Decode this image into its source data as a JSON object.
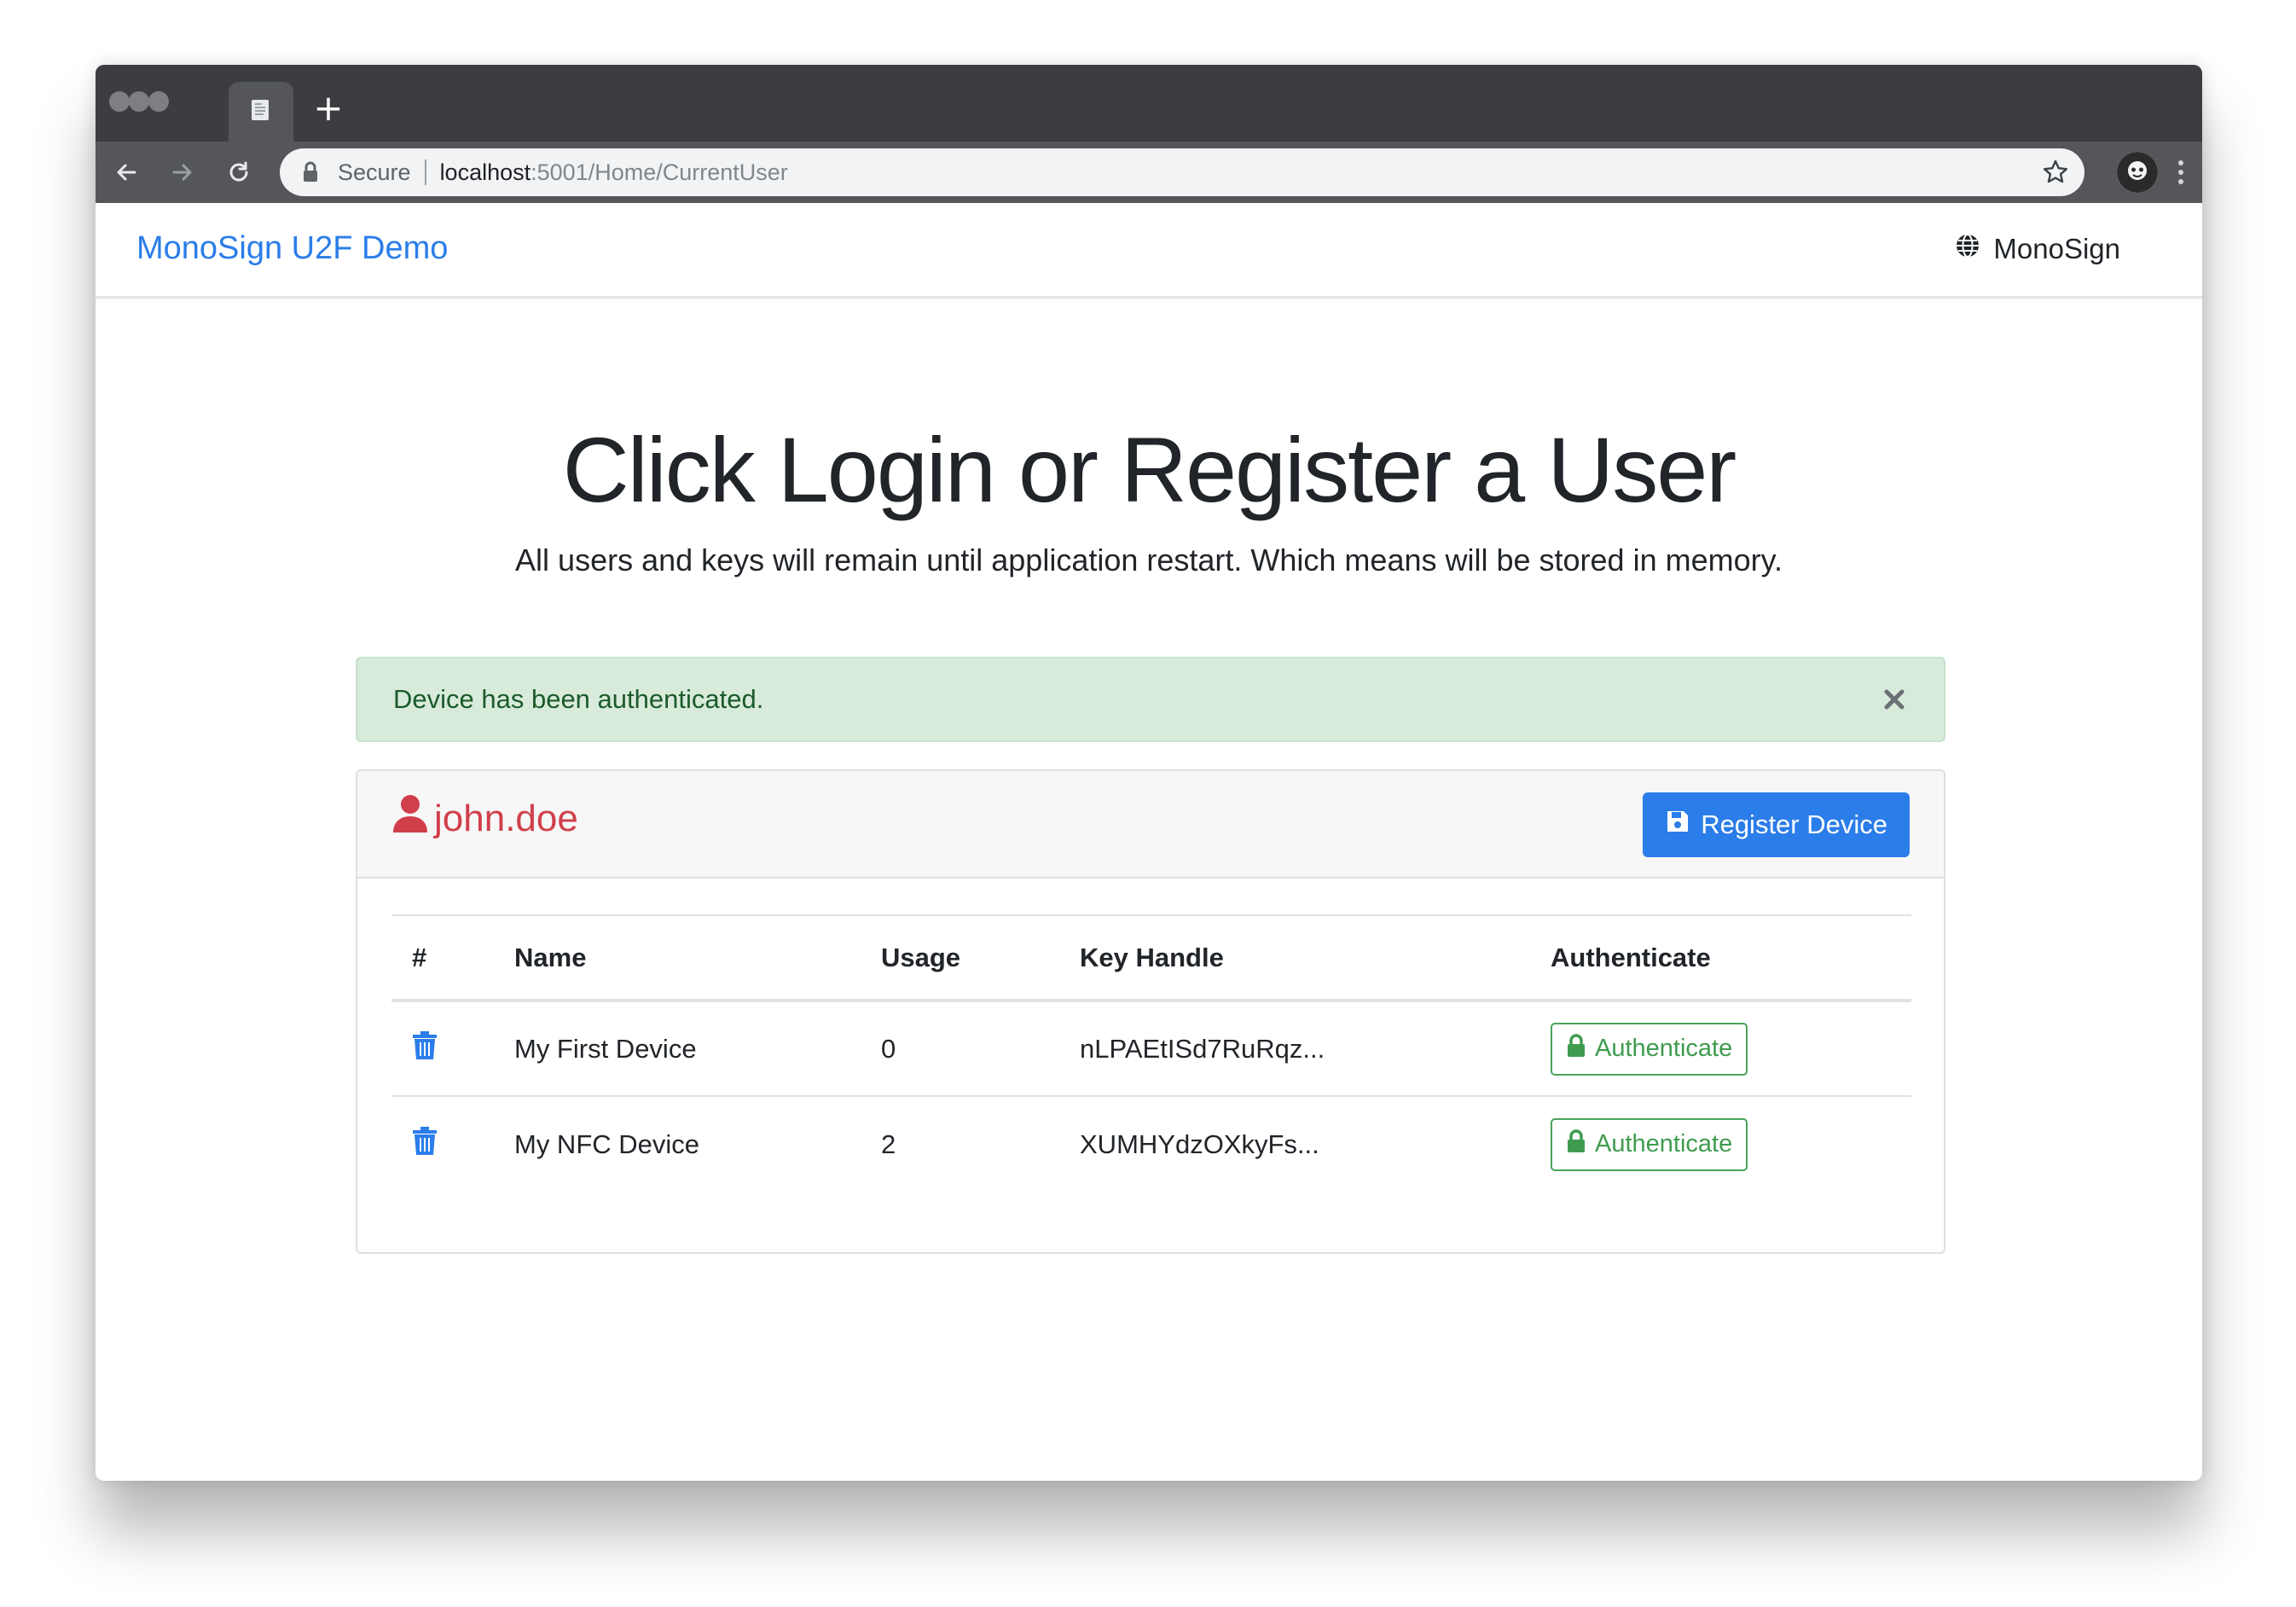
{
  "browser": {
    "new_tab_symbol": "+",
    "url_secure_label": "Secure",
    "url_host": "localhost",
    "url_path": ":5001/Home/CurrentUser",
    "icons": [
      "back-arrow-icon",
      "forward-arrow-icon",
      "reload-icon",
      "lock-icon",
      "star-icon",
      "profile-avatar-icon",
      "more-menu-icon",
      "page-icon"
    ]
  },
  "navbar": {
    "brand": "MonoSign U2F Demo",
    "right_link": "MonoSign",
    "right_icon": "globe-icon"
  },
  "hero": {
    "title": "Click Login or Register a User",
    "subtitle": "All users and keys will remain until application restart. Which means will be stored in memory."
  },
  "alert": {
    "message": "Device has been authenticated.",
    "color": "#d8ebdb"
  },
  "card": {
    "username": "john.doe",
    "user_icon": "user-icon",
    "register_button": "Register Device",
    "register_icon": "save-icon",
    "table": {
      "headers": [
        "#",
        "Name",
        "Usage",
        "Key Handle",
        "Authenticate"
      ],
      "rows": [
        {
          "name": "My First Device",
          "usage": "0",
          "key_handle": "nLPAEtISd7RuRqz...",
          "action": "Authenticate"
        },
        {
          "name": "My NFC Device",
          "usage": "2",
          "key_handle": "XUMHYdzOXkyFs...",
          "action": "Authenticate"
        }
      ]
    }
  },
  "colors": {
    "brand_blue": "#2b7de9",
    "user_red": "#d13f4b",
    "success_green": "#3f9c4f"
  }
}
